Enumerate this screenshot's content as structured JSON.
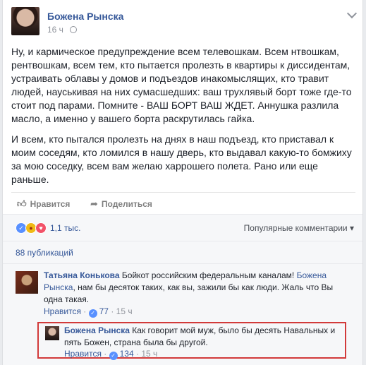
{
  "post": {
    "author": "Божена Рынска",
    "time": "16 ч",
    "paragraphs": [
      "Ну, и кармическое предупреждение всем телевошкам. Всем нтвошкам, рентвошкам, всем тем, кто пытается пролезть в квартиры к диссидентам, устраивать облавы у домов и подъездов инакомыслящих, кто травит людей, науськивая на них сумасшедших: ваш трухлявый борт тоже где-то стоит под парами. Помните - ВАШ БОРТ ВАШ ЖДЕТ. Аннушка разлила масло, а именно у вашего борта раскрутилась гайка.",
      "И всем, кто пытался пролезть на днях в наш подъезд, кто приставал к моим соседям, кто ломился в нашу дверь, кто выдавал какую-то бомжиху за мою соседку, всем вам желаю харрошего полета. Рано или еще раньше."
    ]
  },
  "actions": {
    "like": "Нравится",
    "share": "Поделиться"
  },
  "reactions": {
    "count": "1,1 тыс.",
    "sort": "Популярные комментарии"
  },
  "shares": "88 публикаций",
  "comment": {
    "author": "Татьяна Конькова",
    "text_before": "Бойкот российским федеральным каналам!",
    "mention": "Божена Рынска",
    "text_after": ", нам бы десяток таких, как вы, зажили бы как люди. Жаль что Вы одна такая.",
    "like": "Нравится",
    "likes": "77",
    "time": "15 ч"
  },
  "reply": {
    "author": "Божена Рынска",
    "text": "Как говорит мой муж, было бы десять Навальных и пять Божен, страна была бы другой.",
    "like": "Нравится",
    "likes": "134",
    "time": "15 ч"
  },
  "colors": {
    "link": "#365899",
    "highlight_border": "#d23a3a"
  }
}
